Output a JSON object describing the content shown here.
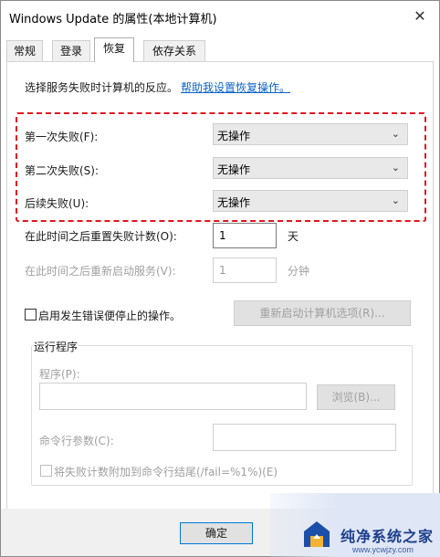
{
  "window": {
    "title": "Windows Update 的属性(本地计算机)",
    "close_glyph": "✕"
  },
  "tabs": [
    {
      "label": "常规"
    },
    {
      "label": "登录"
    },
    {
      "label": "恢复"
    },
    {
      "label": "依存关系"
    }
  ],
  "recovery": {
    "intro": "选择服务失败时计算机的反应。",
    "help_link": "帮助我设置恢复操作。",
    "first_failure": {
      "label": "第一次失败(F):",
      "value": "无操作"
    },
    "second_failure": {
      "label": "第二次失败(S):",
      "value": "无操作"
    },
    "subsequent_failure": {
      "label": "后续失败(U):",
      "value": "无操作"
    },
    "reset_count": {
      "label": "在此时间之后重置失败计数(O):",
      "value": "1",
      "unit": "天"
    },
    "restart_service": {
      "label": "在此时间之后重新启动服务(V):",
      "value": "1",
      "unit": "分钟"
    },
    "enable_actions": {
      "label": "启用发生错误便停止的操作。",
      "checked": false
    },
    "restart_options_button": "重新启动计算机选项(R)..."
  },
  "run_program": {
    "group_title": "运行程序",
    "program_label": "程序(P):",
    "program_value": "",
    "browse_button": "浏览(B)...",
    "params_label": "命令行参数(C):",
    "params_value": "",
    "append_label": "将失败计数附加到命令行结尾(/fail=%1%)(E)",
    "append_checked": false
  },
  "footer": {
    "ok_button": "确定"
  },
  "watermark": {
    "brand": "纯净系统之家",
    "url": "www.ycwjzy.com"
  },
  "colors": {
    "highlight_border": "#e0141e",
    "link": "#0a63c9",
    "primary_border": "#0078d7"
  }
}
